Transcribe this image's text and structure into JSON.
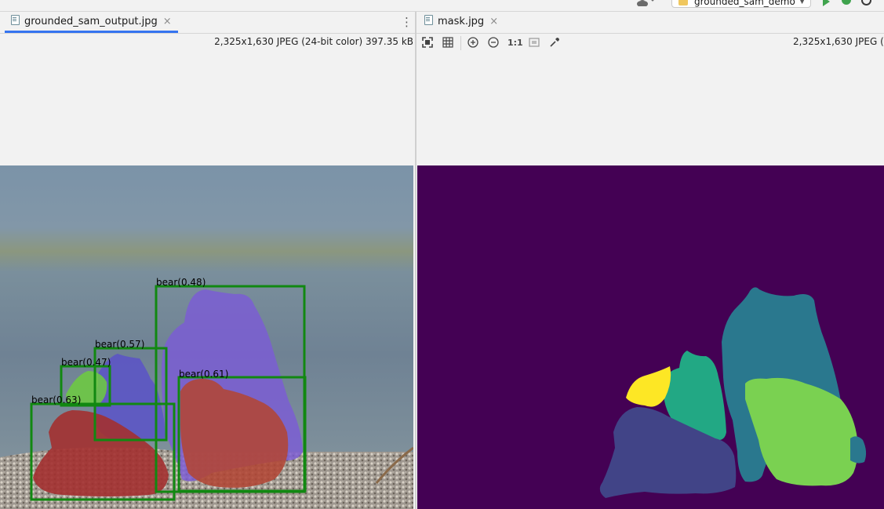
{
  "toolbar": {
    "run_config_label": "grounded_sam_demo",
    "icons": [
      "user-icon",
      "run-icon",
      "debug-icon",
      "profile-icon"
    ]
  },
  "left_pane": {
    "tab": {
      "label": "grounded_sam_output.jpg",
      "close": "×",
      "icon": "image-file-icon"
    },
    "more": "⋮",
    "image_info": "2,325x1,630 JPEG (24-bit color) 397.35 kB",
    "detections": [
      {
        "label": "bear(0.48)",
        "color": "#7b5cd6"
      },
      {
        "label": "bear(0.57)",
        "color": "#5a52c8"
      },
      {
        "label": "bear(0.47)",
        "color": "#6dcc3e"
      },
      {
        "label": "bear(0.61)",
        "color": "#b24634"
      },
      {
        "label": "bear(0.63)",
        "color": "#a33030"
      }
    ],
    "box_color": "#118811"
  },
  "right_pane": {
    "tab": {
      "label": "mask.jpg",
      "close": "×",
      "icon": "image-file-icon"
    },
    "image_info": "2,325x1,630 JPEG (",
    "toolbar_icons": [
      "fit-screen-icon",
      "grid-icon",
      "zoom-in-icon",
      "zoom-out-icon",
      "actual-size-icon",
      "background-icon",
      "color-picker-icon"
    ],
    "actual_size_label": "1:1",
    "mask_colors": {
      "background": "#440154",
      "big_bear": "#2a788e",
      "right_bear": "#7ad151",
      "middle_bear": "#22a884",
      "small_bear": "#fde725",
      "lying_bear": "#414487"
    }
  }
}
